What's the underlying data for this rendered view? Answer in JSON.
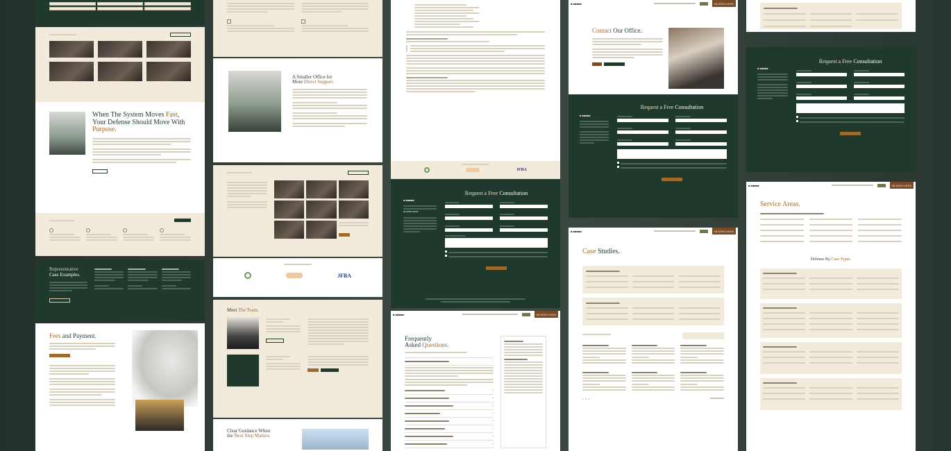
{
  "col1": {
    "top_tags": [
      "",
      "",
      "",
      "",
      "",
      "",
      "",
      "",
      ""
    ],
    "hero_title_a": "When The System Moves ",
    "hero_title_b": "Fast",
    "hero_title_c": ", Your Defense Should Move With ",
    "hero_title_d": "Purpose",
    "hero_title_e": ".",
    "rep_title_a": "Representative",
    "rep_title_b": "Case Examples.",
    "fees_title_a": "Fees",
    "fees_title_b": " and Payment."
  },
  "col2": {
    "smaller_title_a": "A Smaller Office for",
    "smaller_title_b": "More ",
    "smaller_title_c": "Direct Support.",
    "meet_title_a": "Meet ",
    "meet_title_b": "The Team.",
    "clear_title_a": "Clear Guidance When",
    "clear_title_b": "the ",
    "clear_title_c": "Next Step Matters.",
    "badge_a": "JFBA"
  },
  "col3": {
    "consult_title_a": "Request a Free ",
    "consult_title_b": "Consultation",
    "faq_title_a": "Frequently",
    "faq_title_b": "Asked ",
    "faq_title_c": "Questions.",
    "badge_a": "JFBA",
    "phone": "03-XXXX-XXXX"
  },
  "col4": {
    "contact_title_a": "Contact ",
    "contact_title_b": "Our Office.",
    "consult_title_a": "Request a Free ",
    "consult_title_b": "Consultation",
    "case_title_a": "Case ",
    "case_title_b": "Studies.",
    "phone": "03-XXXX-XXXX",
    "pager": "1 · 2 · 3"
  },
  "col5": {
    "consult_title_a": "Request a Free ",
    "consult_title_b": "Consultation",
    "service_title_a": "Service ",
    "service_title_b": "Areas.",
    "defense_title_a": "Defense By ",
    "defense_title_b": "Case Types.",
    "phone": "03-XXXX-XXXX"
  },
  "colors": {
    "green": "#1f3a2c",
    "accent": "#a06a2c",
    "cream": "#f2ebdc"
  }
}
